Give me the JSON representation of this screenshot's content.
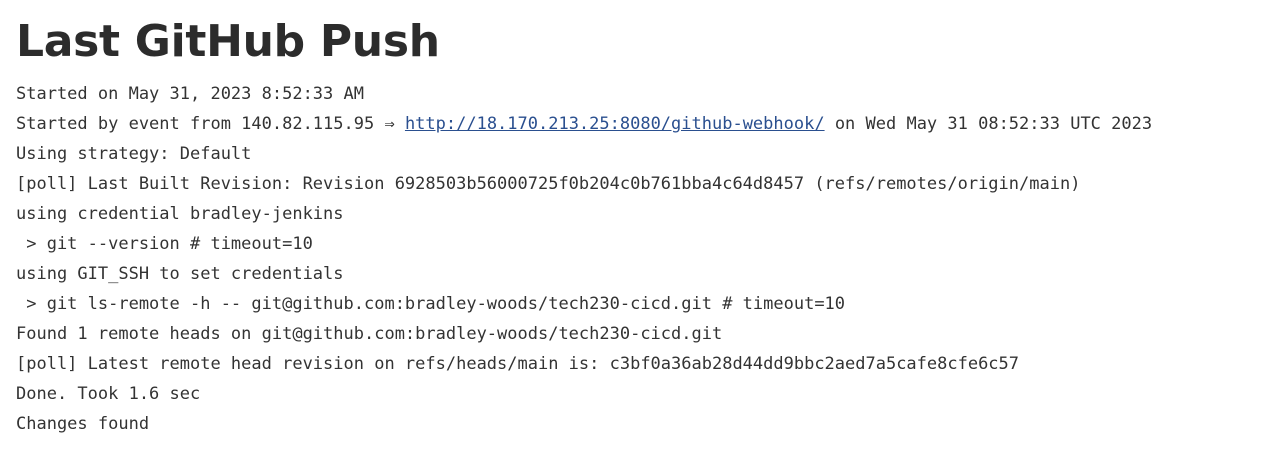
{
  "page": {
    "title": "Last GitHub Push"
  },
  "console": {
    "lines": {
      "started_on": "Started on May 31, 2023 8:52:33 AM",
      "started_by_prefix": "Started by event from 140.82.115.95 ⇒ ",
      "webhook_url": "http://18.170.213.25:8080/github-webhook/",
      "started_by_suffix": " on Wed May 31 08:52:33 UTC 2023",
      "strategy": "Using strategy: Default",
      "last_built": "[poll] Last Built Revision: Revision 6928503b56000725f0b204c0b761bba4c64d8457 (refs/remotes/origin/main)",
      "credential": "using credential bradley-jenkins",
      "git_version": " > git --version # timeout=10",
      "git_ssh": "using GIT_SSH to set credentials",
      "ls_remote": " > git ls-remote -h -- git@github.com:bradley-woods/tech230-cicd.git # timeout=10",
      "found_heads": "Found 1 remote heads on git@github.com:bradley-woods/tech230-cicd.git",
      "latest_head": "[poll] Latest remote head revision on refs/heads/main is: c3bf0a36ab28d44dd9bbc2aed7a5cafe8cfe6c57",
      "done": "Done. Took 1.6 sec",
      "changes": "Changes found"
    }
  },
  "colors": {
    "text": "#333333",
    "title": "#2c2c2c",
    "link": "#2a4f8f"
  }
}
